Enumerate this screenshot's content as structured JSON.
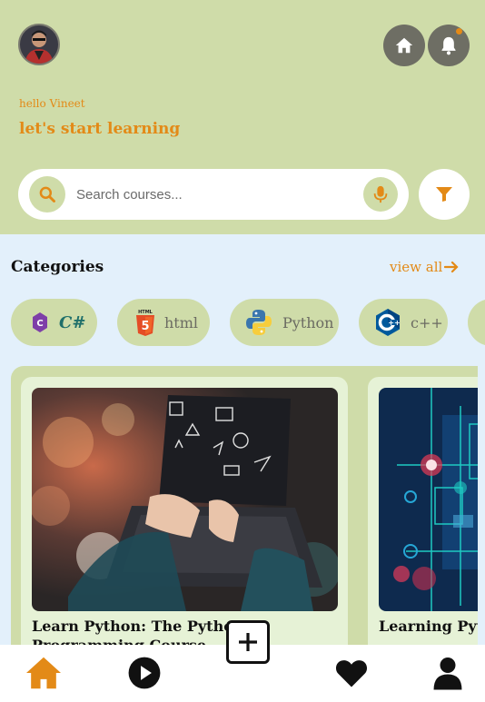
{
  "header": {
    "greeting": "hello Vineet",
    "headline": "let's start learning",
    "avatar_icon": "user-avatar",
    "home_icon": "home-icon",
    "bell_icon": "bell-icon"
  },
  "search": {
    "placeholder": "Search courses...",
    "value": "",
    "search_icon": "search-icon",
    "mic_icon": "mic-icon",
    "filter_icon": "filter-icon"
  },
  "categories": {
    "title": "Categories",
    "view_all": "view all",
    "items": [
      {
        "label": "",
        "logo": "csharp-logo"
      },
      {
        "label": "html",
        "logo": "html5-logo"
      },
      {
        "label": "Python",
        "logo": "python-logo"
      },
      {
        "label": "c++",
        "logo": "cpp-logo"
      }
    ]
  },
  "courses": [
    {
      "title": "Learn Python: The Python Programming Course"
    },
    {
      "title": "Learning Python Visualization"
    }
  ],
  "bottom_nav": {
    "items": [
      "home-icon",
      "play-icon",
      "add-icon",
      "heart-icon",
      "profile-icon"
    ]
  },
  "colors": {
    "accent": "#e38a17",
    "header_bg": "#cfdca9",
    "page_bg": "#e3f0fb",
    "icon_dark": "#6e6e64"
  }
}
